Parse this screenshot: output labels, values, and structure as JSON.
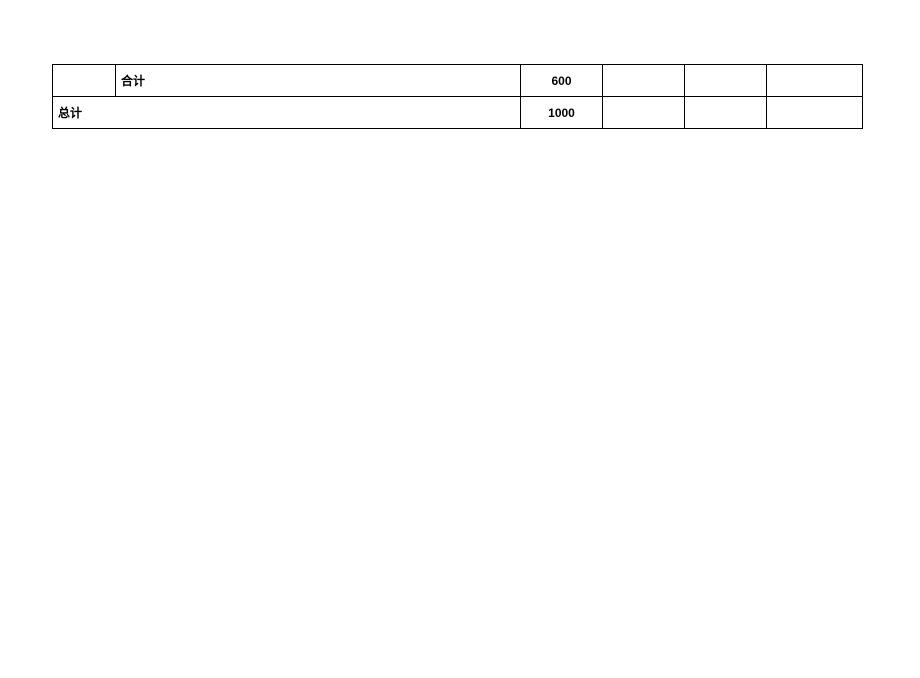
{
  "table": {
    "row1": {
      "col_a": "",
      "label": "合计",
      "value": "600",
      "col_d": "",
      "col_e": "",
      "col_f": ""
    },
    "row2": {
      "label": "总计",
      "value": "1000",
      "col_d": "",
      "col_e": "",
      "col_f": ""
    }
  }
}
